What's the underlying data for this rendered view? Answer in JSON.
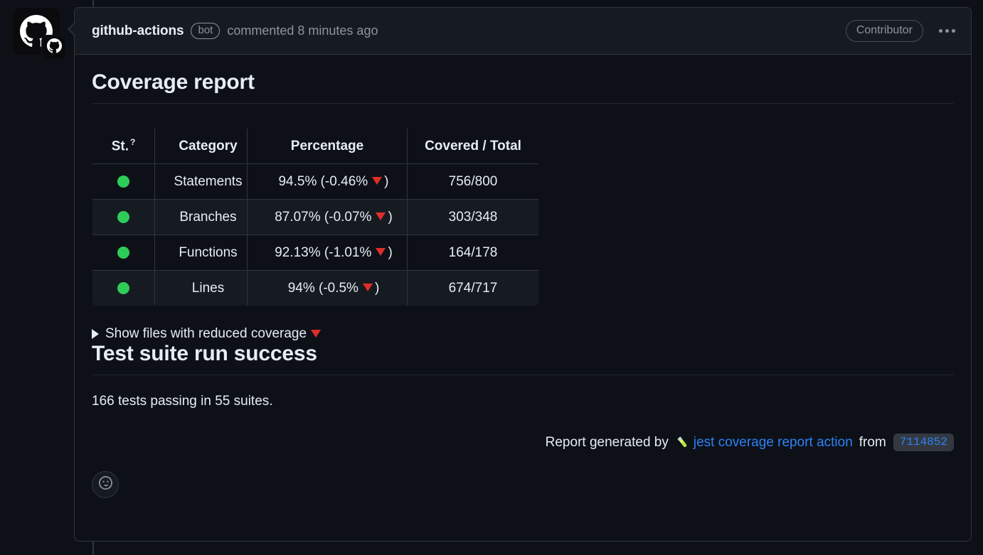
{
  "timeline": {
    "rail_color": "#30363d"
  },
  "avatar": {
    "name": "github-actions",
    "icon": "github-octocat-icon",
    "badge_icon": "github-mark-badge-icon"
  },
  "header": {
    "author": "github-actions",
    "bot_label": "bot",
    "commented_text": "commented 8 minutes ago",
    "contributor_label": "Contributor",
    "menu_icon": "kebab-horizontal-icon"
  },
  "coverage": {
    "title": "Coverage report",
    "table": {
      "columns": [
        "St.",
        "Category",
        "Percentage",
        "Covered / Total"
      ],
      "status_help_glyph": "?",
      "rows": [
        {
          "status": "green",
          "category": "Statements",
          "percentage": "94.5% (-0.46%",
          "trend": "down",
          "percentage_close": ")",
          "covered_total": "756/800"
        },
        {
          "status": "green",
          "category": "Branches",
          "percentage": "87.07% (-0.07%",
          "trend": "down",
          "percentage_close": ")",
          "covered_total": "303/348"
        },
        {
          "status": "green",
          "category": "Functions",
          "percentage": "92.13% (-1.01%",
          "trend": "down",
          "percentage_close": ")",
          "covered_total": "164/178"
        },
        {
          "status": "green",
          "category": "Lines",
          "percentage": "94% (-0.5%",
          "trend": "down",
          "percentage_close": ")",
          "covered_total": "674/717"
        }
      ]
    },
    "details_label": "Show files with reduced coverage"
  },
  "tests": {
    "title": "Test suite run success",
    "summary": "166 tests passing in 55 suites."
  },
  "footer": {
    "prefix": "Report generated by",
    "link_emoji": "test-tube-emoji",
    "link_text": "jest coverage report action",
    "from_label": "from",
    "sha": "7114852"
  },
  "reactions": {
    "add_reaction_icon": "smiley-icon"
  },
  "colors": {
    "page_bg": "#0d1117",
    "box_border": "#30363d",
    "header_bg": "#161b22",
    "text": "#e6edf3",
    "muted": "#8b949e",
    "link": "#2f81f7",
    "status_green": "#2ecc58",
    "trend_red": "#e02d28",
    "row_alt_bg": "#161b22",
    "sha_badge_bg": "#343941"
  }
}
